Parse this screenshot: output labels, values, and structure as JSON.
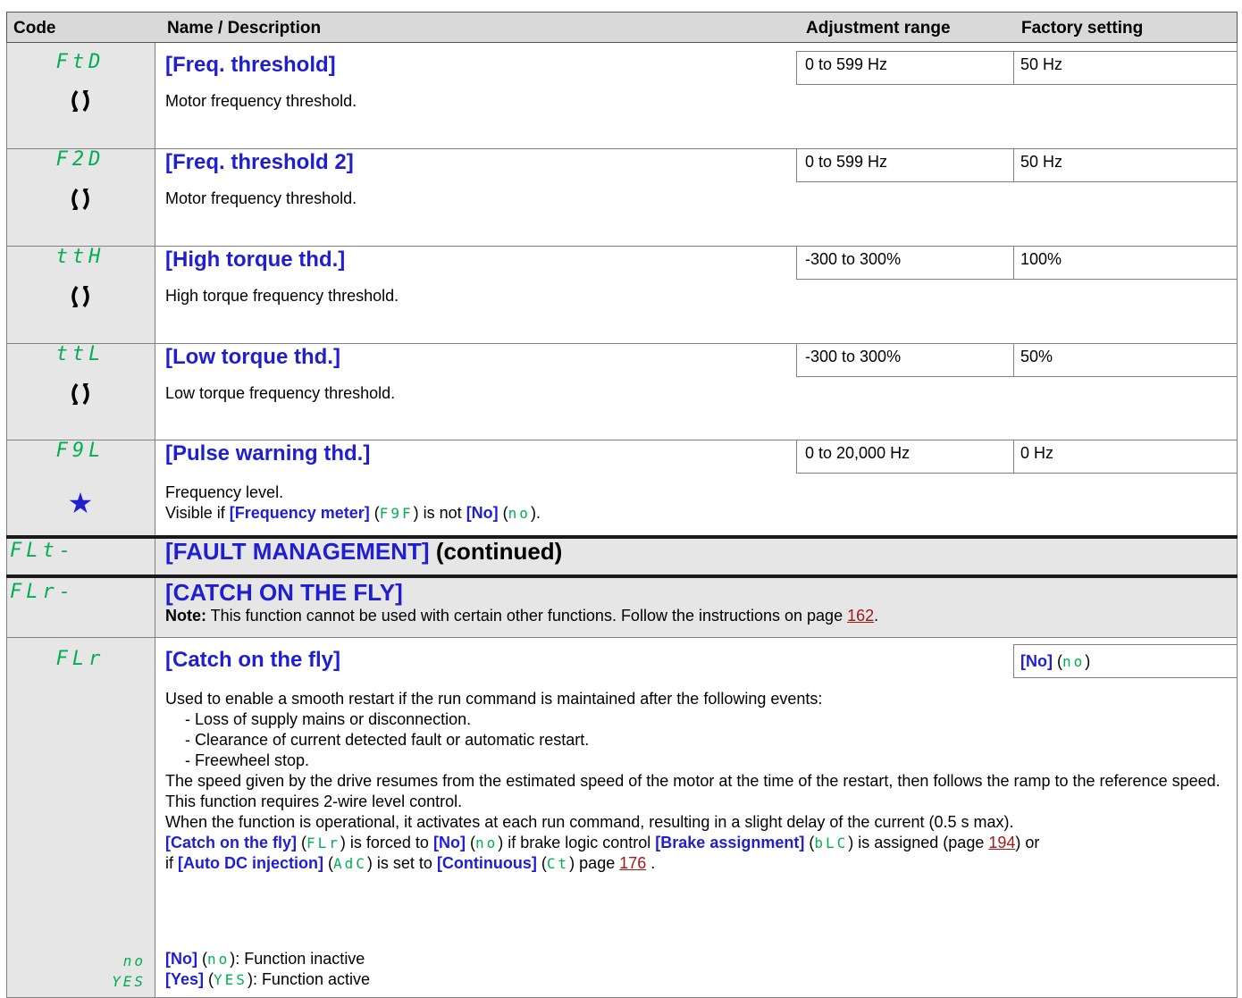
{
  "header": {
    "code": "Code",
    "name": "Name / Description",
    "range": "Adjustment range",
    "factory": "Factory setting"
  },
  "rows": [
    {
      "code": "FtD",
      "name": "[Freq. threshold]",
      "range": "0 to 599 Hz",
      "factory": "50 Hz",
      "desc": "Motor frequency threshold.",
      "icon": "rotating-arrows-icon"
    },
    {
      "code": "F2D",
      "name": "[Freq. threshold 2]",
      "range": "0 to 599 Hz",
      "factory": "50 Hz",
      "desc": "Motor frequency threshold.",
      "icon": "rotating-arrows-icon"
    },
    {
      "code": "ttH",
      "name": "[High torque thd.]",
      "range": "-300 to 300%",
      "factory": "100%",
      "desc": "High torque frequency threshold.",
      "icon": "rotating-arrows-icon"
    },
    {
      "code": "ttL",
      "name": "[Low torque thd.]",
      "range": "-300 to 300%",
      "factory": "50%",
      "desc": "Low torque frequency threshold.",
      "icon": "rotating-arrows-icon"
    },
    {
      "code": "F9L",
      "name": "[Pulse warning thd.]",
      "range": "0 to 20,000 Hz",
      "factory": "0 Hz",
      "desc": "Frequency level.",
      "icon": "star-icon",
      "visible": {
        "pre": "Visible if ",
        "b1": "[Frequency meter]",
        "c1": "F9F",
        "mid": " is not ",
        "b2": "[No]",
        "c2": "no",
        "post": "."
      }
    }
  ],
  "section_fault": {
    "code": "FLt-",
    "title": "[FAULT MANAGEMENT]",
    "suffix": " (continued)"
  },
  "section_catch": {
    "code": "FLr-",
    "title": "[CATCH ON THE FLY]",
    "note_label": "Note:",
    "note_text": " This function cannot be used with certain other functions. Follow the instructions on page ",
    "note_page": "162",
    "note_end": "."
  },
  "catch_param": {
    "code": "FLr",
    "name": "[Catch on the fly]",
    "factory_b": "[No]",
    "factory_c": "no",
    "intro": "Used to enable a smooth restart if the run command is maintained after the following events:",
    "bullets": [
      "- Loss of supply mains or disconnection.",
      "- Clearance of current detected fault or automatic restart.",
      "- Freewheel stop."
    ],
    "p1": "The speed given by the drive resumes from the estimated speed of the motor at the time of the restart, then follows the ramp to the reference speed.",
    "p2": "This function requires 2-wire level control.",
    "p3": "When the function is operational, it activates at each run command, resulting in a slight delay of the current (0.5 s max).",
    "forced": {
      "b1": "[Catch on the fly]",
      "c1": "FLr",
      "t1": " is forced to ",
      "b2": "[No]",
      "c2": "no",
      "t2": " if brake logic control ",
      "b3": "[Brake assignment]",
      "c3": "bLC",
      "t3": " is assigned (page ",
      "page1": "194",
      "t4": ") or",
      "t5": "if ",
      "b4": "[Auto DC injection]",
      "c4": "AdC",
      "t6": " is set to ",
      "b5": "[Continuous]",
      "c5": "Ct",
      "t7": " page ",
      "page2": "176",
      "t8": " ."
    },
    "options": [
      {
        "code": "no",
        "label": "[No]",
        "code2": "no",
        "text": ": Function inactive"
      },
      {
        "code": "YES",
        "label": "[Yes]",
        "code2": "YES",
        "text": ": Function active"
      }
    ]
  }
}
